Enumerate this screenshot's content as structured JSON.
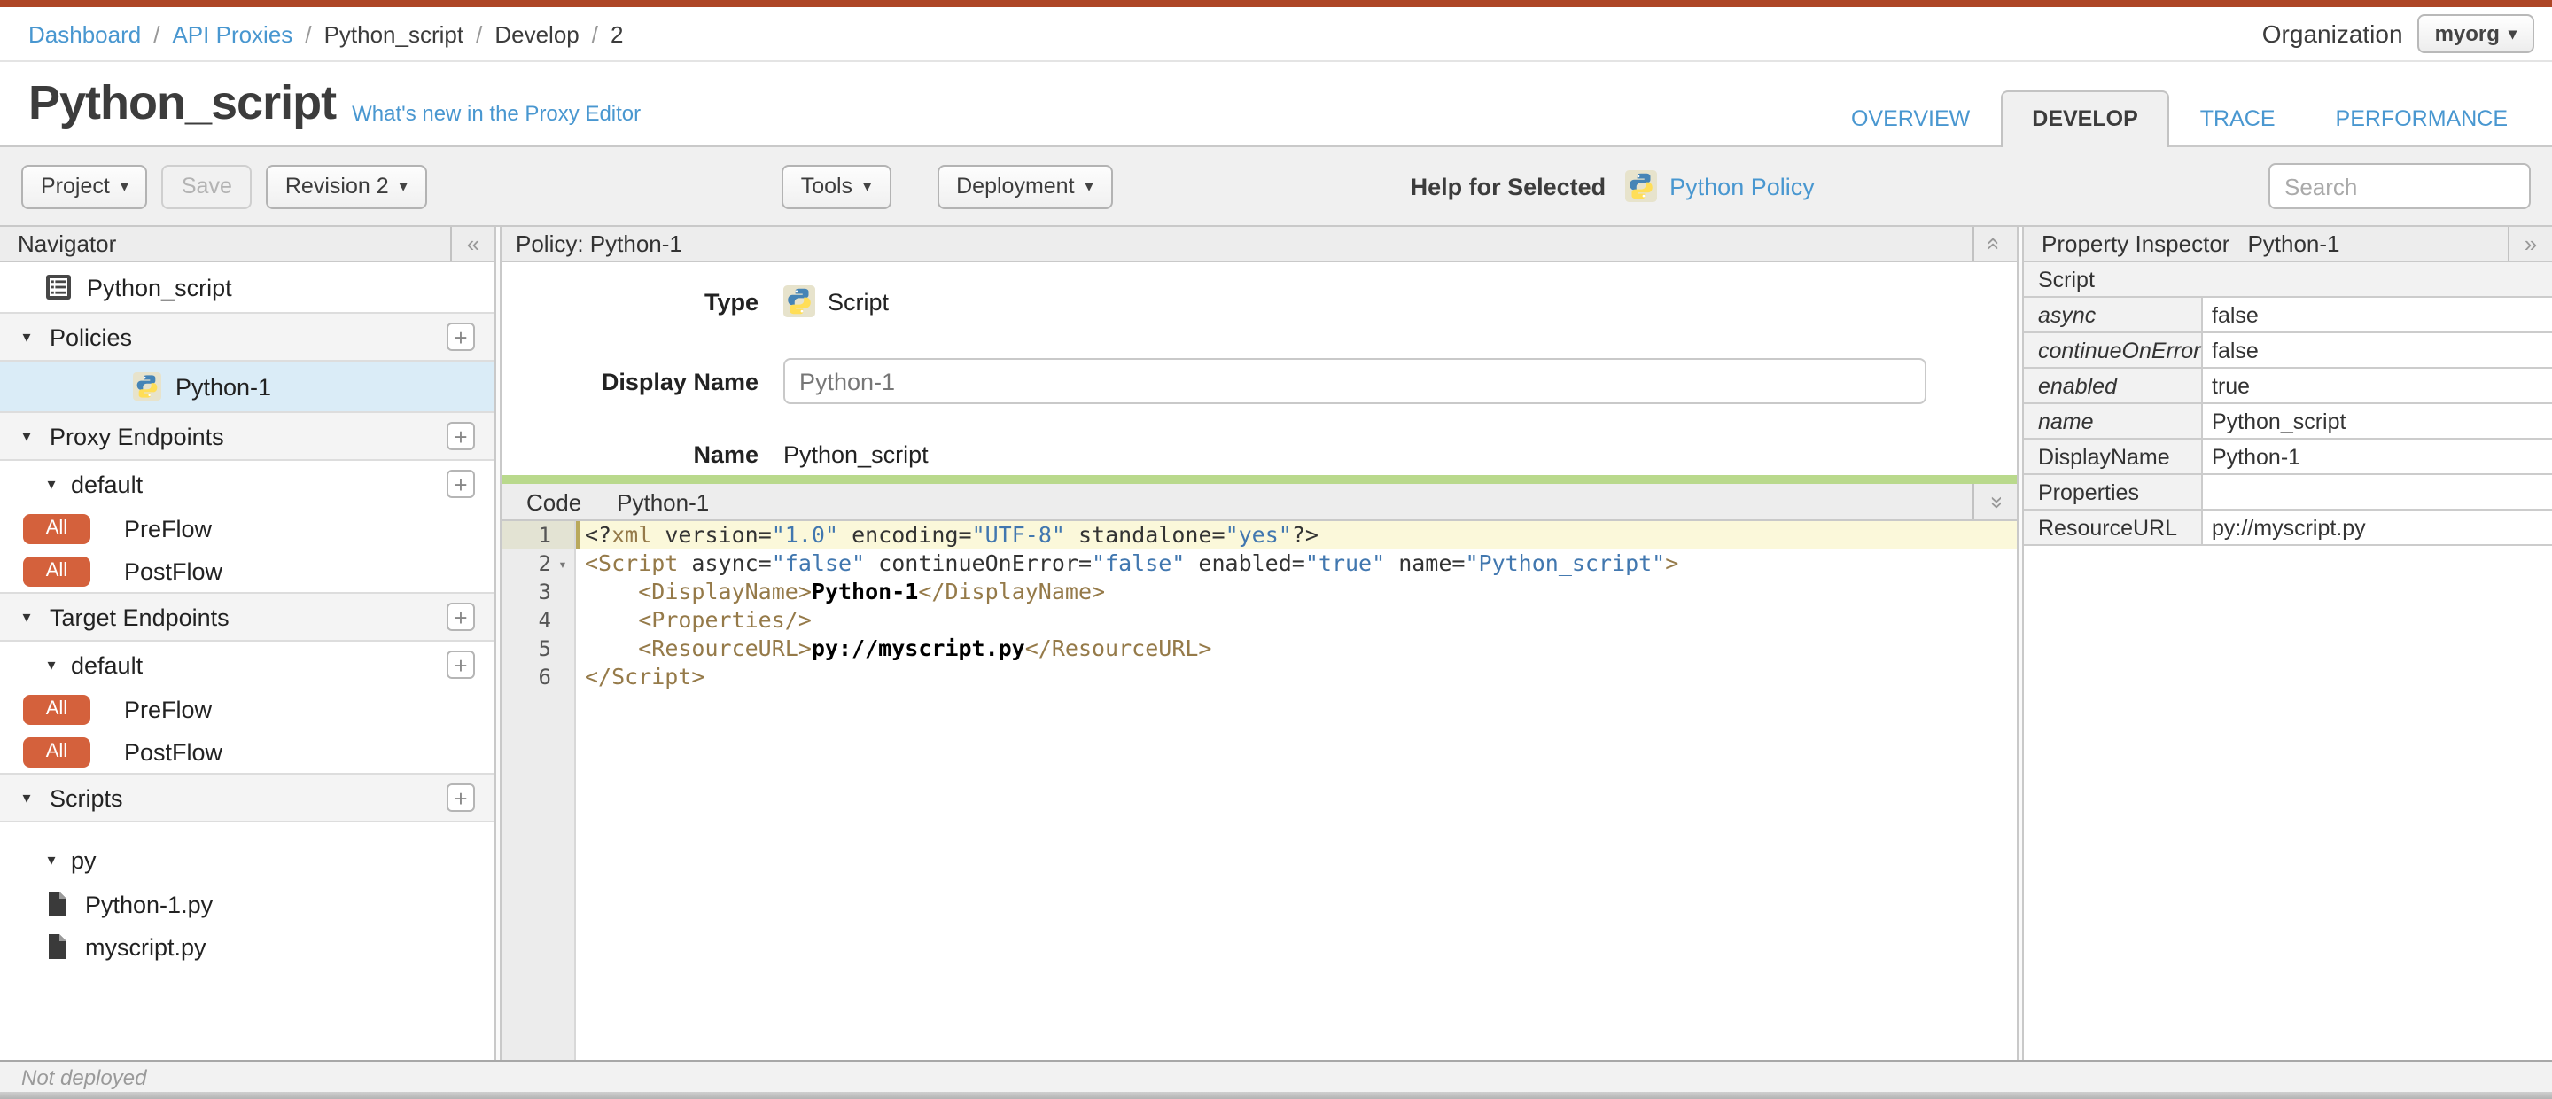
{
  "icons": {
    "collapse_left": "«",
    "expand_right": "»",
    "collapse_vertical": "«",
    "dropdown_caret": "▾",
    "tree_caret": "▾",
    "add": "+"
  },
  "colors": {
    "accent_red": "#ae4626",
    "link_blue": "#4997d0",
    "badge_red": "#d4613c",
    "selected_row": "#daecf7",
    "green_splitter": "#b9d98c"
  },
  "breadcrumb": {
    "separator": "/",
    "items": [
      {
        "label": "Dashboard",
        "link": true
      },
      {
        "label": "API Proxies",
        "link": true
      },
      {
        "label": "Python_script",
        "link": false
      },
      {
        "label": "Develop",
        "link": false
      },
      {
        "label": "2",
        "link": false
      }
    ]
  },
  "organization": {
    "label": "Organization",
    "selected": "myorg"
  },
  "page": {
    "title": "Python_script",
    "whats_new_link": "What's new in the Proxy Editor"
  },
  "tabs": [
    {
      "label": "OVERVIEW",
      "active": false
    },
    {
      "label": "DEVELOP",
      "active": true
    },
    {
      "label": "TRACE",
      "active": false
    },
    {
      "label": "PERFORMANCE",
      "active": false
    }
  ],
  "toolbar": {
    "project": "Project",
    "save": "Save",
    "revision": "Revision 2",
    "tools": "Tools",
    "deployment": "Deployment",
    "help_for_selected": "Help for Selected",
    "policy_help_link": "Python Policy",
    "search_placeholder": "Search"
  },
  "navigator": {
    "header": "Navigator",
    "root_item": "Python_script",
    "policies_section": "Policies",
    "policy_item": "Python-1",
    "proxy_endpoints_section": "Proxy Endpoints",
    "proxy_default": "default",
    "proxy_flows": [
      {
        "badge": "All",
        "label": "PreFlow"
      },
      {
        "badge": "All",
        "label": "PostFlow"
      }
    ],
    "target_endpoints_section": "Target Endpoints",
    "target_default": "default",
    "target_flows": [
      {
        "badge": "All",
        "label": "PreFlow"
      },
      {
        "badge": "All",
        "label": "PostFlow"
      }
    ],
    "scripts_section": "Scripts",
    "scripts_group": "py",
    "script_files": [
      "Python-1.py",
      "myscript.py"
    ]
  },
  "policy_panel": {
    "header": "Policy: Python-1",
    "type_label": "Type",
    "type_value": "Script",
    "display_name_label": "Display Name",
    "display_name_value": "Python-1",
    "name_label": "Name",
    "name_value": "Python_script"
  },
  "code_panel": {
    "header_label": "Code",
    "header_file": "Python-1",
    "lines": [
      {
        "n": 1,
        "active": true,
        "fold": false,
        "tokens": [
          [
            "pl",
            "<?"
          ],
          [
            "tg",
            "xml"
          ],
          [
            "at",
            " version="
          ],
          [
            "st",
            "\"1.0\""
          ],
          [
            "at",
            " encoding="
          ],
          [
            "st",
            "\"UTF-8\""
          ],
          [
            "at",
            " standalone="
          ],
          [
            "st",
            "\"yes\""
          ],
          [
            "pl",
            "?>"
          ]
        ]
      },
      {
        "n": 2,
        "active": false,
        "fold": true,
        "tokens": [
          [
            "tg",
            "<Script"
          ],
          [
            "at",
            " async="
          ],
          [
            "st",
            "\"false\""
          ],
          [
            "at",
            " continueOnError="
          ],
          [
            "st",
            "\"false\""
          ],
          [
            "at",
            " enabled="
          ],
          [
            "st",
            "\"true\""
          ],
          [
            "at",
            " name="
          ],
          [
            "st",
            "\"Python_script\""
          ],
          [
            "tg",
            ">"
          ]
        ]
      },
      {
        "n": 3,
        "active": false,
        "fold": false,
        "tokens": [
          [
            "at",
            "    "
          ],
          [
            "tg",
            "<DisplayName>"
          ],
          [
            "tx",
            "Python-1"
          ],
          [
            "tg",
            "</DisplayName>"
          ]
        ]
      },
      {
        "n": 4,
        "active": false,
        "fold": false,
        "tokens": [
          [
            "at",
            "    "
          ],
          [
            "tg",
            "<Properties/>"
          ]
        ]
      },
      {
        "n": 5,
        "active": false,
        "fold": false,
        "tokens": [
          [
            "at",
            "    "
          ],
          [
            "tg",
            "<ResourceURL>"
          ],
          [
            "tx",
            "py://myscript.py"
          ],
          [
            "tg",
            "</ResourceURL>"
          ]
        ]
      },
      {
        "n": 6,
        "active": false,
        "fold": false,
        "tokens": [
          [
            "tg",
            "</Script>"
          ]
        ]
      }
    ]
  },
  "property_inspector": {
    "header": "Property Inspector",
    "header_context": "Python-1",
    "section": "Script",
    "rows": [
      {
        "label": "async",
        "value": "false",
        "italic": true
      },
      {
        "label": "continueOnError",
        "value": "false",
        "italic": true
      },
      {
        "label": "enabled",
        "value": "true",
        "italic": true
      },
      {
        "label": "name",
        "value": "Python_script",
        "italic": true
      },
      {
        "label": "DisplayName",
        "value": "Python-1",
        "italic": false
      },
      {
        "label": "Properties",
        "value": "",
        "italic": false
      },
      {
        "label": "ResourceURL",
        "value": "py://myscript.py",
        "italic": false
      }
    ]
  },
  "statusbar": {
    "text": "Not deployed"
  }
}
